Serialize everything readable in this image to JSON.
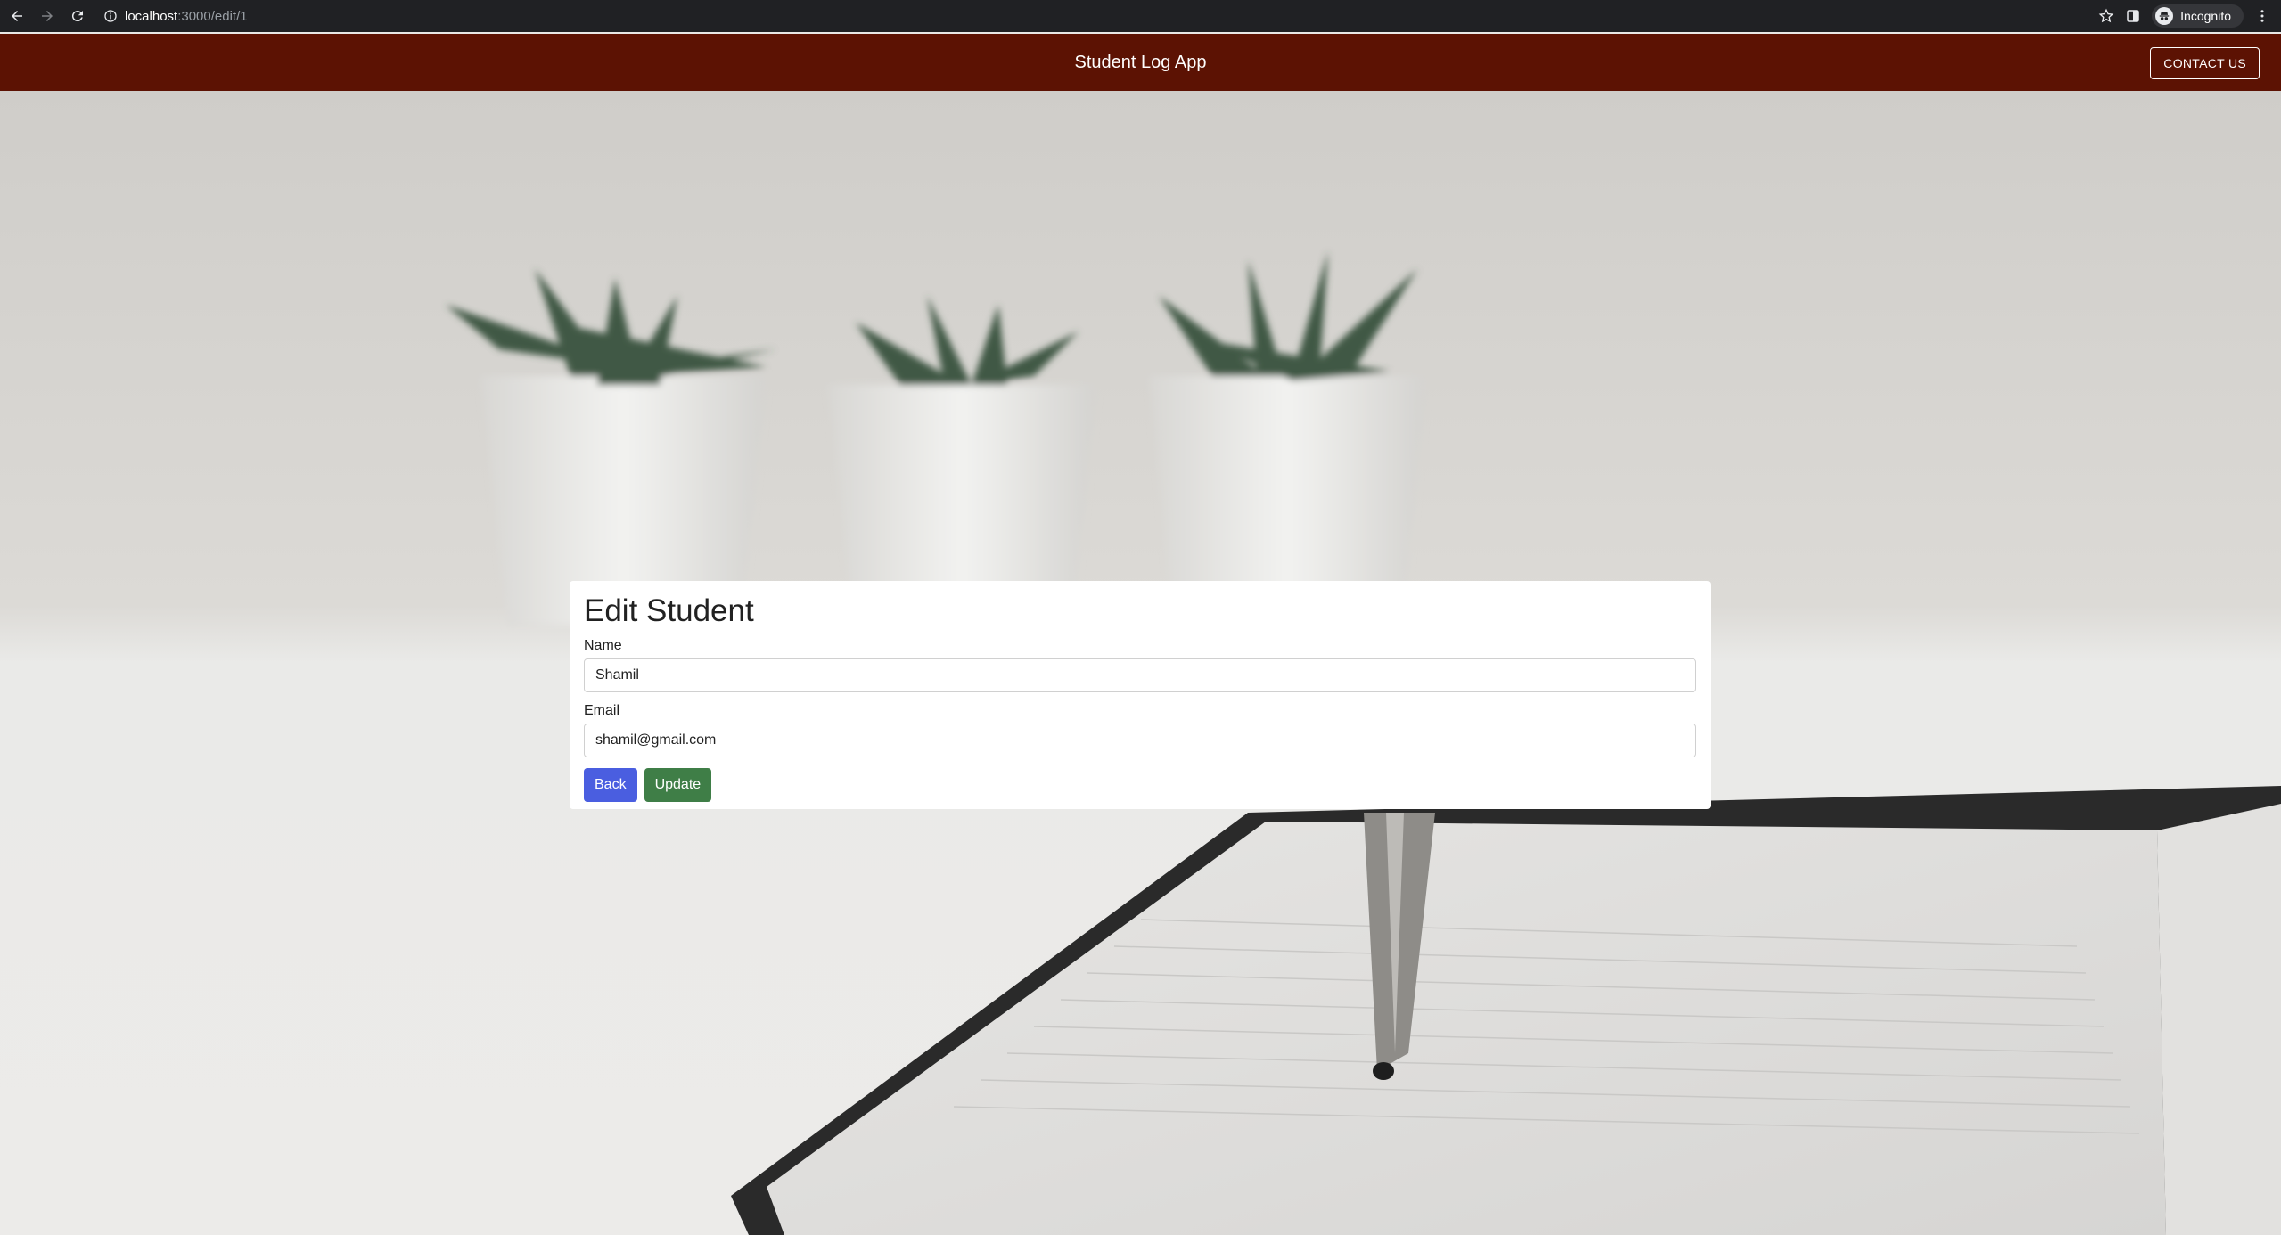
{
  "browser": {
    "url_host": "localhost",
    "url_path": ":3000/edit/1",
    "profile_label": "Incognito"
  },
  "appbar": {
    "title": "Student Log App",
    "contact_label": "CONTACT US"
  },
  "form": {
    "heading": "Edit Student",
    "name_label": "Name",
    "name_value": "Shamil",
    "email_label": "Email",
    "email_value": "shamil@gmail.com",
    "back_label": "Back",
    "update_label": "Update"
  },
  "colors": {
    "appbar_bg": "#5c1203",
    "back_button": "#4a5ee0",
    "update_button": "#3f7e47"
  }
}
